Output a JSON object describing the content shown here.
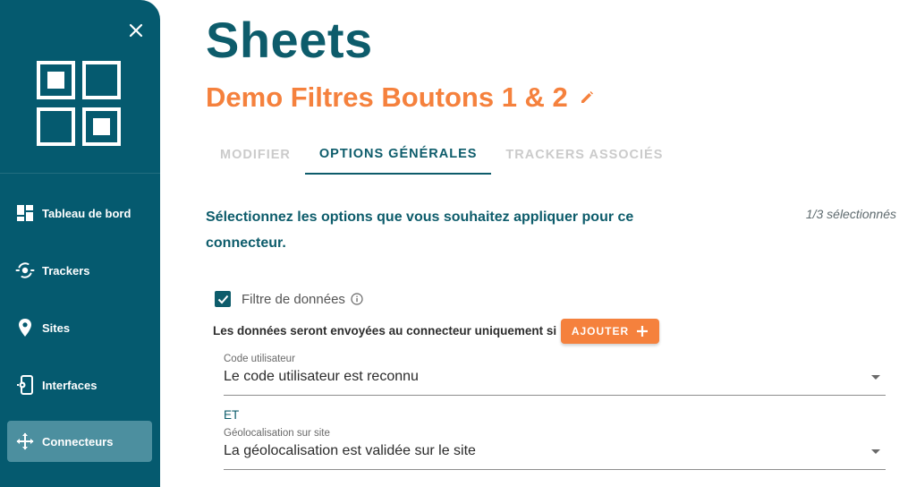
{
  "sidebar": {
    "items": [
      {
        "label": "Tableau de bord",
        "icon": "dashboard-icon",
        "active": false
      },
      {
        "label": "Trackers",
        "icon": "tracker-icon",
        "active": false
      },
      {
        "label": "Sites",
        "icon": "location-pin-icon",
        "active": false
      },
      {
        "label": "Interfaces",
        "icon": "interface-device-icon",
        "active": false
      },
      {
        "label": "Connecteurs",
        "icon": "connector-arrows-icon",
        "active": true
      }
    ]
  },
  "header": {
    "title": "Sheets",
    "subtitle": "Demo Filtres Boutons 1 & 2"
  },
  "tabs": [
    {
      "label": "MODIFIER",
      "active": false
    },
    {
      "label": "OPTIONS GÉNÉRALES",
      "active": true
    },
    {
      "label": "TRACKERS ASSOCIÉS",
      "active": false
    }
  ],
  "options": {
    "intro": "Sélectionnez les options que vous souhaitez appliquer pour ce connecteur.",
    "selected_count": "1/3 sélectionnés",
    "filter_label": "Filtre de données",
    "filter_checked": true,
    "condition_text": "Les données seront envoyées au connecteur uniquement si :",
    "add_button": "AJOUTER",
    "conditions": [
      {
        "caption": "Code utilisateur",
        "value": "Le code utilisateur est reconnu"
      },
      {
        "caption": "Géolocalisation sur site",
        "value": "La géolocalisation est validée sur le site"
      }
    ],
    "and_label": "ET"
  },
  "colors": {
    "sidebar_bg": "#055a6f",
    "sidebar_active": "#4c8f9f",
    "primary": "#0d5c6b",
    "accent": "#f5813d",
    "tab_inactive": "#cbcbcb"
  }
}
